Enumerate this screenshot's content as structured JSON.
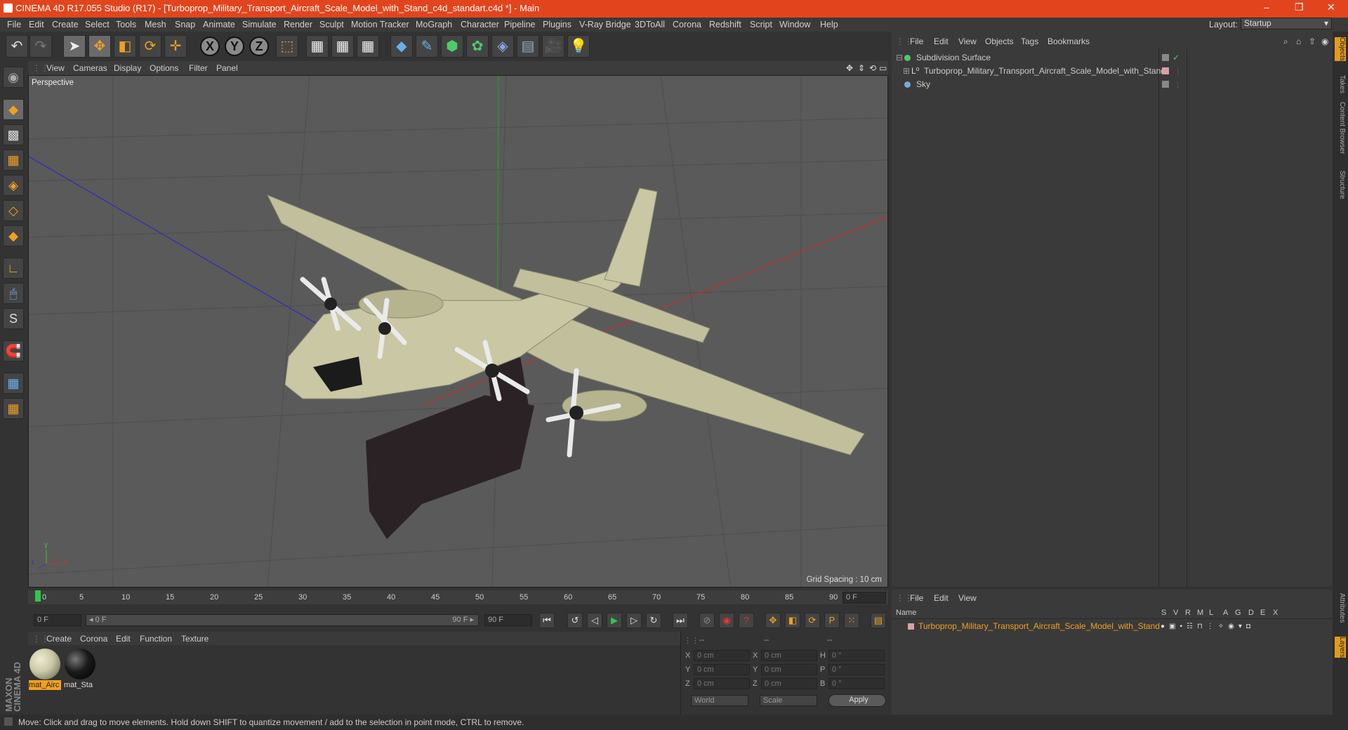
{
  "window": {
    "title": "CINEMA 4D R17.055 Studio (R17) - [Turboprop_Military_Transport_Aircraft_Scale_Model_with_Stand_c4d_standart.c4d *] - Main",
    "controls": [
      "–",
      "❐",
      "✕"
    ]
  },
  "menubar": [
    "File",
    "Edit",
    "Create",
    "Select",
    "Tools",
    "Mesh",
    "Snap",
    "Animate",
    "Simulate",
    "Render",
    "Sculpt",
    "Motion Tracker",
    "MoGraph",
    "Character",
    "Pipeline",
    "Plugins",
    "V-Ray Bridge",
    "3DToAll",
    "Corona",
    "Redshift",
    "Script",
    "Window",
    "Help"
  ],
  "layout": {
    "label": "Layout:",
    "value": "Startup"
  },
  "viewport": {
    "menu": [
      "View",
      "Cameras",
      "Display",
      "Options",
      "Filter",
      "Panel"
    ],
    "name": "Perspective",
    "grid_spacing": "Grid Spacing : 10 cm",
    "axis_labels": {
      "x": "x",
      "y": "y",
      "z": "z"
    }
  },
  "timeline": {
    "ticks": [
      "0",
      "5",
      "10",
      "15",
      "20",
      "25",
      "30",
      "35",
      "40",
      "45",
      "50",
      "55",
      "60",
      "65",
      "70",
      "75",
      "80",
      "85",
      "90"
    ],
    "current_frame": "0 F",
    "start_field": "0 F",
    "range_left": "◂ 0 F",
    "range_right": "90 F ▸",
    "end_field": "90 F"
  },
  "materials": {
    "menu": [
      "Create",
      "Corona",
      "Edit",
      "Function",
      "Texture"
    ],
    "items": [
      {
        "label": "mat_Airc",
        "color": "#c9c7a4"
      },
      {
        "label": "mat_Sta",
        "color": "#1a1a1a"
      }
    ]
  },
  "coords": {
    "headers": [
      "--",
      "--",
      "--"
    ],
    "rows": [
      {
        "a": "X",
        "av": "0 cm",
        "b": "X",
        "bv": "0 cm",
        "c": "H",
        "cv": "0 °"
      },
      {
        "a": "Y",
        "av": "0 cm",
        "b": "Y",
        "bv": "0 cm",
        "c": "P",
        "cv": "0 °"
      },
      {
        "a": "Z",
        "av": "0 cm",
        "b": "Z",
        "bv": "0 cm",
        "c": "B",
        "cv": "0 °"
      }
    ],
    "world": "World",
    "scale": "Scale",
    "apply": "Apply"
  },
  "objects": {
    "menu": [
      "File",
      "Edit",
      "View",
      "Objects",
      "Tags",
      "Bookmarks"
    ],
    "rows": [
      {
        "name": "Subdivision Surface"
      },
      {
        "name": "Turboprop_Military_Transport_Aircraft_Scale_Model_with_Stand"
      },
      {
        "name": "Sky"
      }
    ]
  },
  "layers": {
    "menu": [
      "File",
      "Edit",
      "View"
    ],
    "name_header": "Name",
    "cols": [
      "S",
      "V",
      "R",
      "M",
      "L",
      "A",
      "G",
      "D",
      "E",
      "X"
    ],
    "row": "Turboprop_Military_Transport_Aircraft_Scale_Model_with_Stand"
  },
  "sidetabs": [
    "Objects",
    "Takes",
    "Content Browser",
    "Structure",
    "Attributes",
    "Layers"
  ],
  "status": "Move: Click and drag to move elements. Hold down SHIFT to quantize movement / add to the selection in point mode, CTRL to remove.",
  "brand": "MAXON CINEMA 4D",
  "colors": {
    "accent": "#e2451d",
    "selection": "#f0a020",
    "aircraft": "#c9c7a4",
    "stand": "#2a2224"
  }
}
